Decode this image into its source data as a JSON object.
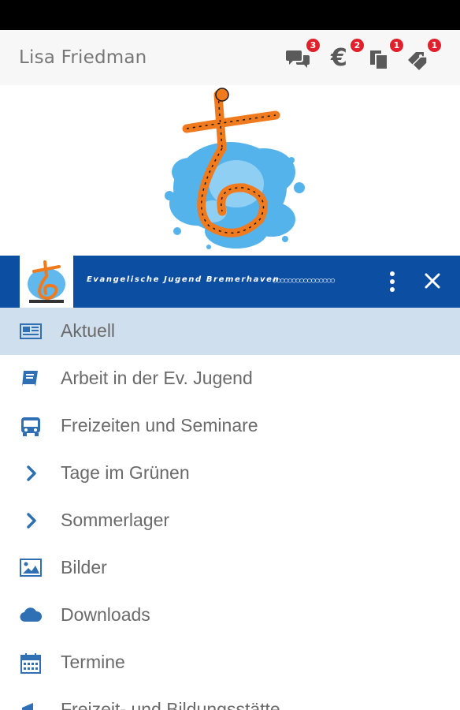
{
  "header": {
    "user_name": "Lisa Friedman",
    "icons": [
      {
        "name": "chat-icon",
        "badge": "3"
      },
      {
        "name": "euro-icon",
        "badge": "2"
      },
      {
        "name": "documents-icon",
        "badge": "1"
      },
      {
        "name": "tags-icon",
        "badge": "1"
      }
    ]
  },
  "brand": {
    "text": "Evangelische Jugend Bremerhaven",
    "chain": "○○○○○○○○○○○○○○○○"
  },
  "menu": {
    "items": [
      {
        "label": "Aktuell",
        "icon": "newspaper-icon",
        "active": true
      },
      {
        "label": "Arbeit in der Ev. Jugend",
        "icon": "book-icon",
        "active": false
      },
      {
        "label": "Freizeiten und Seminare",
        "icon": "bus-icon",
        "active": false
      },
      {
        "label": "Tage im Grünen",
        "icon": "chevron-right-icon",
        "active": false
      },
      {
        "label": "Sommerlager",
        "icon": "chevron-right-icon",
        "active": false
      },
      {
        "label": "Bilder",
        "icon": "image-icon",
        "active": false
      },
      {
        "label": "Downloads",
        "icon": "cloud-icon",
        "active": false
      },
      {
        "label": "Termine",
        "icon": "calendar-icon",
        "active": false
      },
      {
        "label": "Freizeit- und Bildungsstätte",
        "icon": "megaphone-icon",
        "active": false
      }
    ]
  },
  "colors": {
    "brand_blue": "#0b4ea2",
    "active_row": "#cfdfee",
    "icon_blue": "#2f6fb4",
    "badge_red": "#e0202b",
    "logo_orange": "#f07a1e",
    "splash_blue": "#38a6e8"
  }
}
